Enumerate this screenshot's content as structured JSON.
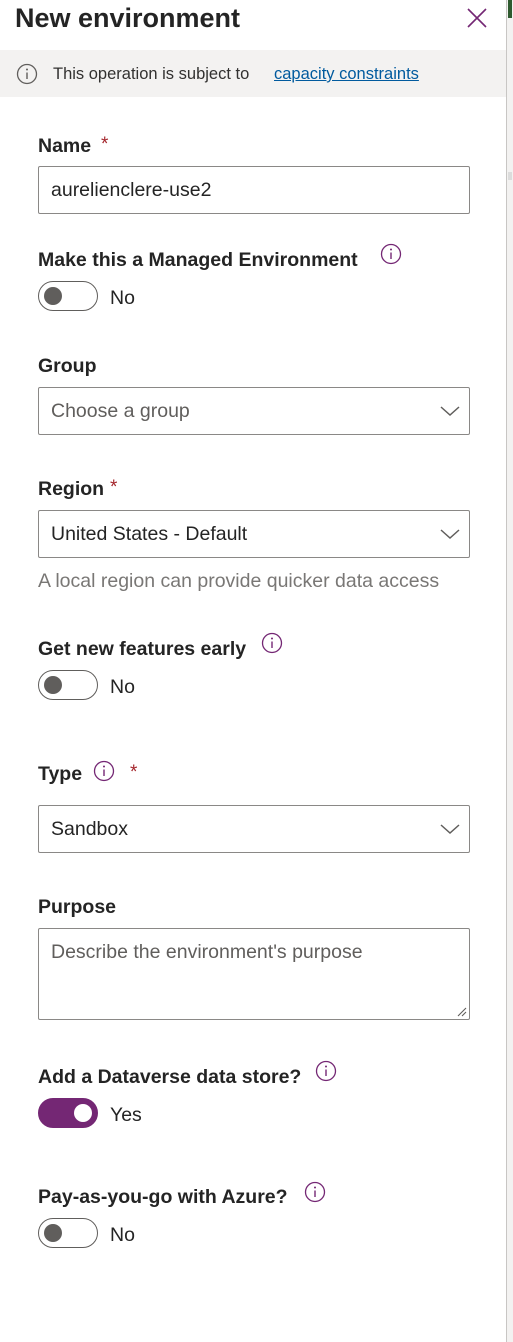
{
  "panel": {
    "title": "New environment",
    "close_icon": "close-icon"
  },
  "notice": {
    "text": "This operation is subject to",
    "link": "capacity constraints",
    "icon": "info-icon"
  },
  "name": {
    "label": "Name",
    "required": "*",
    "value": "aurelienclere-use2"
  },
  "managed": {
    "label": "Make this a Managed Environment",
    "state": "No",
    "on": false
  },
  "group": {
    "label": "Group",
    "placeholder": "Choose a group"
  },
  "region": {
    "label": "Region",
    "required": "*",
    "value": "United States - Default",
    "hint": "A local region can provide quicker data access"
  },
  "early": {
    "label": "Get new features early",
    "state": "No",
    "on": false
  },
  "type": {
    "label": "Type",
    "required": "*",
    "value": "Sandbox"
  },
  "purpose": {
    "label": "Purpose",
    "placeholder": "Describe the environment's purpose"
  },
  "dataverse": {
    "label": "Add a Dataverse data store?",
    "state": "Yes",
    "on": true
  },
  "payg": {
    "label": "Pay-as-you-go with Azure?",
    "state": "No",
    "on": false
  },
  "colors": {
    "accent": "#742774",
    "required": "#a4262c",
    "link": "#005a9e",
    "notice_bg": "#f3f2f1"
  }
}
